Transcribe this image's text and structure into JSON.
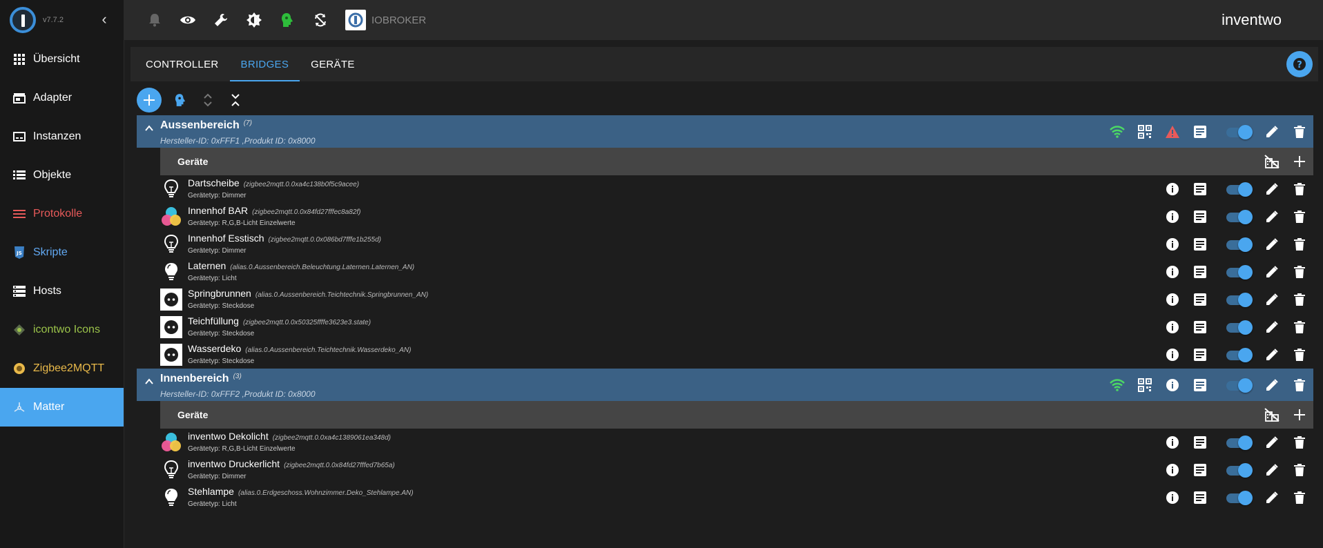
{
  "app": {
    "version": "v7.7.2",
    "title": "inventwo",
    "host_label": "IOBROKER"
  },
  "sidebar": {
    "items": [
      {
        "label": "Übersicht",
        "icon": "grid-icon"
      },
      {
        "label": "Adapter",
        "icon": "store-icon"
      },
      {
        "label": "Instanzen",
        "icon": "instances-icon"
      },
      {
        "label": "Objekte",
        "icon": "list-icon"
      },
      {
        "label": "Protokolle",
        "icon": "logs-icon"
      },
      {
        "label": "Skripte",
        "icon": "js-icon"
      },
      {
        "label": "Hosts",
        "icon": "hosts-icon"
      },
      {
        "label": "icontwo Icons",
        "icon": "icontwo-icon"
      },
      {
        "label": "Zigbee2MQTT",
        "icon": "zigbee-icon"
      },
      {
        "label": "Matter",
        "icon": "matter-icon"
      }
    ],
    "active": "Matter"
  },
  "tabs": [
    {
      "label": "CONTROLLER"
    },
    {
      "label": "BRIDGES"
    },
    {
      "label": "GERÄTE"
    }
  ],
  "active_tab": "BRIDGES",
  "bridges": [
    {
      "name": "Aussenbereich",
      "count": "(7)",
      "ids": "Hersteller-ID: 0xFFF1   ,Produkt ID: 0x8000",
      "devices_header": "Geräte",
      "devices": [
        {
          "name": "Dartscheibe",
          "oid": "(zigbee2mqtt.0.0xa4c138b0f5c9acee)",
          "type": "Gerätetyp: Dimmer",
          "icon": "bulb-outline-icon"
        },
        {
          "name": "Innenhof BAR",
          "oid": "(zigbee2mqtt.0.0x84fd27fffec8a82f)",
          "type": "Gerätetyp: R,G,B-Licht Einzelwerte",
          "icon": "rgb-light-icon"
        },
        {
          "name": "Innenhof Esstisch",
          "oid": "(zigbee2mqtt.0.0x086bd7fffe1b255d)",
          "type": "Gerätetyp: Dimmer",
          "icon": "bulb-outline-icon"
        },
        {
          "name": "Laternen",
          "oid": "(alias.0.Aussenbereich.Beleuchtung.Laternen.Laternen_AN)",
          "type": "Gerätetyp: Licht",
          "icon": "bulb-filled-icon"
        },
        {
          "name": "Springbrunnen",
          "oid": "(alias.0.Aussenbereich.Teichtechnik.Springbrunnen_AN)",
          "type": "Gerätetyp: Steckdose",
          "icon": "socket-icon"
        },
        {
          "name": "Teichfüllung",
          "oid": "(zigbee2mqtt.0.0x50325ffffe3623e3.state)",
          "type": "Gerätetyp: Steckdose",
          "icon": "socket-icon"
        },
        {
          "name": "Wasserdeko",
          "oid": "(alias.0.Aussenbereich.Teichtechnik.Wasserdeko_AN)",
          "type": "Gerätetyp: Steckdose",
          "icon": "socket-icon"
        }
      ]
    },
    {
      "name": "Innenbereich",
      "count": "(3)",
      "ids": "Hersteller-ID: 0xFFF2   ,Produkt ID: 0x8000",
      "devices_header": "Geräte",
      "devices": [
        {
          "name": "inventwo Dekolicht",
          "oid": "(zigbee2mqtt.0.0xa4c1389061ea348d)",
          "type": "Gerätetyp: R,G,B-Licht Einzelwerte",
          "icon": "rgb-light-icon"
        },
        {
          "name": "inventwo Druckerlicht",
          "oid": "(zigbee2mqtt.0.0x84fd27fffed7b65a)",
          "type": "Gerätetyp: Dimmer",
          "icon": "bulb-outline-icon"
        },
        {
          "name": "Stehlampe",
          "oid": "(alias.0.Erdgeschoss.Wohnzimmer.Deko_Stehlampe.AN)",
          "type": "Gerätetyp: Licht",
          "icon": "bulb-filled-icon"
        }
      ]
    }
  ],
  "colors": {
    "accent": "#4aa6ef",
    "bridge_bg": "#3b6185",
    "wifi": "#4cd964",
    "warning": "#e85a5a"
  }
}
